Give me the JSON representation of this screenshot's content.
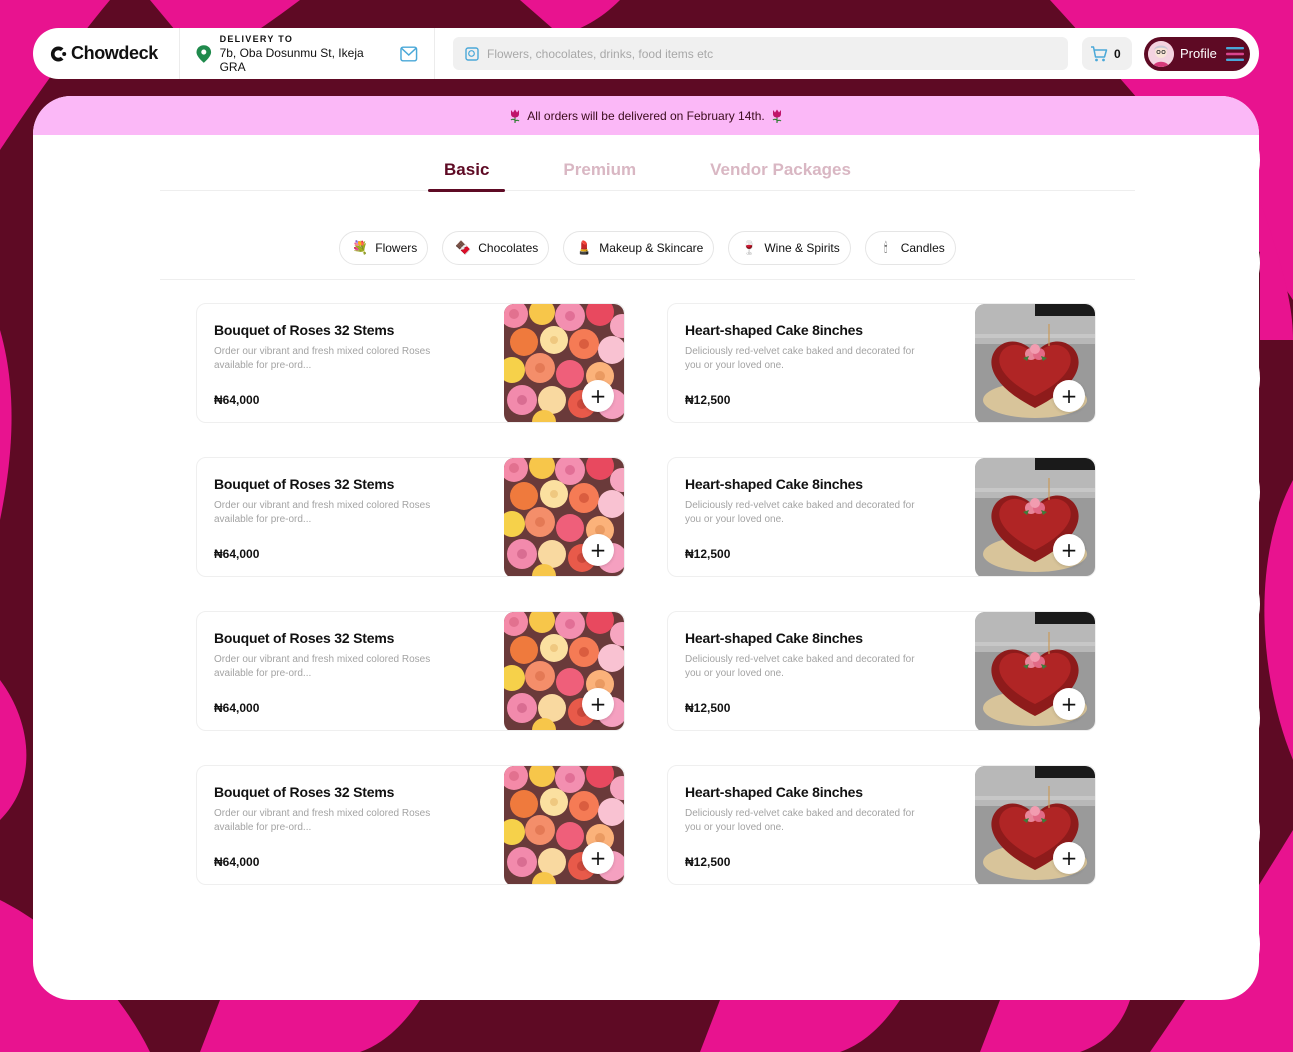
{
  "brand": {
    "name": "Chowdeck"
  },
  "delivery": {
    "label": "DELIVERY TO",
    "address": "7b, Oba Dosunmu St, Ikeja GRA"
  },
  "search": {
    "placeholder": "Flowers, chocolates, drinks, food items etc"
  },
  "cart": {
    "count": "0"
  },
  "profile": {
    "label": "Profile"
  },
  "banner": {
    "text": "All orders will be delivered on February 14th."
  },
  "tabs": [
    {
      "label": "Basic",
      "active": true
    },
    {
      "label": "Premium",
      "active": false
    },
    {
      "label": "Vendor Packages",
      "active": false
    }
  ],
  "categories": [
    {
      "label": "Flowers",
      "icon": "flower-bouquet-icon",
      "glyph": "💐"
    },
    {
      "label": "Chocolates",
      "icon": "chocolate-icon",
      "glyph": "🍫"
    },
    {
      "label": "Makeup & Skincare",
      "icon": "lipstick-icon",
      "glyph": "💄"
    },
    {
      "label": "Wine & Spirits",
      "icon": "wine-icon",
      "glyph": "🍷"
    },
    {
      "label": "Candles",
      "icon": "candle-icon",
      "glyph": "🕯"
    }
  ],
  "products": [
    {
      "title": "Bouquet of Roses 32 Stems",
      "description": "Order our vibrant and fresh mixed colored Roses available for pre-ord...",
      "price": "₦64,000",
      "image": "roses"
    },
    {
      "title": "Heart-shaped Cake 8inches",
      "description": "Deliciously red-velvet cake baked and decorated for you or your loved one.",
      "price": "₦12,500",
      "image": "cake"
    },
    {
      "title": "Bouquet of Roses 32 Stems",
      "description": "Order our vibrant and fresh mixed colored Roses available for pre-ord...",
      "price": "₦64,000",
      "image": "roses"
    },
    {
      "title": "Heart-shaped Cake 8inches",
      "description": "Deliciously red-velvet cake baked and decorated for you or your loved one.",
      "price": "₦12,500",
      "image": "cake"
    },
    {
      "title": "Bouquet of Roses 32 Stems",
      "description": "Order our vibrant and fresh mixed colored Roses available for pre-ord...",
      "price": "₦64,000",
      "image": "roses"
    },
    {
      "title": "Heart-shaped Cake 8inches",
      "description": "Deliciously red-velvet cake baked and decorated for you or your loved one.",
      "price": "₦12,500",
      "image": "cake"
    },
    {
      "title": "Bouquet of Roses 32 Stems",
      "description": "Order our vibrant and fresh mixed colored Roses available for pre-ord...",
      "price": "₦64,000",
      "image": "roses"
    },
    {
      "title": "Heart-shaped Cake 8inches",
      "description": "Deliciously red-velvet cake baked and decorated for you or your loved one.",
      "price": "₦12,500",
      "image": "cake"
    }
  ],
  "colors": {
    "maroon": "#5e0a24",
    "magenta": "#e8138f",
    "banner_pink": "#fbb8f7",
    "tab_inactive": "#d9b7c3"
  }
}
